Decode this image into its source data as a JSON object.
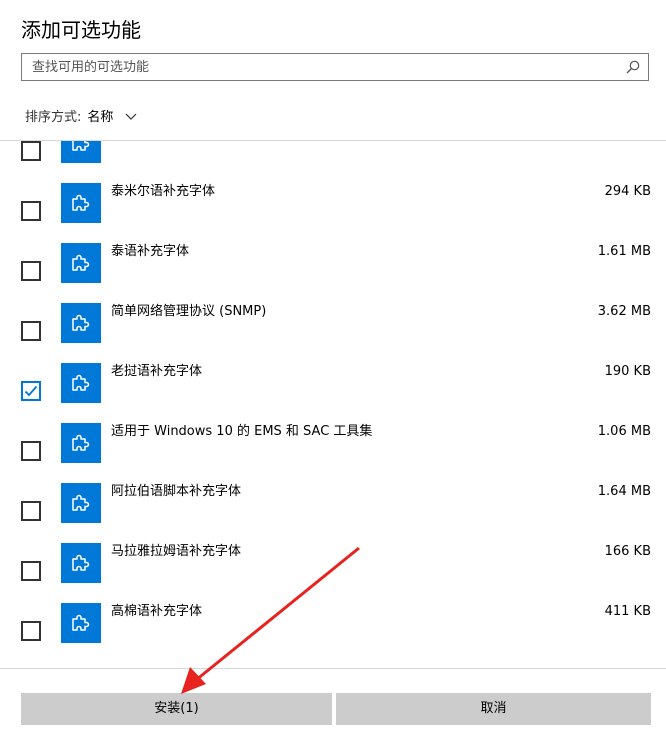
{
  "dialog": {
    "title": "添加可选功能",
    "search_placeholder": "查找可用的可选功能",
    "sort_label": "排序方式:",
    "sort_value": "名称"
  },
  "features": [
    {
      "name": "",
      "size": "",
      "checked": false
    },
    {
      "name": "泰米尔语补充字体",
      "size": "294 KB",
      "checked": false
    },
    {
      "name": "泰语补充字体",
      "size": "1.61 MB",
      "checked": false
    },
    {
      "name": "简单网络管理协议 (SNMP)",
      "size": "3.62 MB",
      "checked": false
    },
    {
      "name": "老挝语补充字体",
      "size": "190 KB",
      "checked": true
    },
    {
      "name": "适用于 Windows 10 的 EMS 和 SAC 工具集",
      "size": "1.06 MB",
      "checked": false
    },
    {
      "name": "阿拉伯语脚本补充字体",
      "size": "1.64 MB",
      "checked": false
    },
    {
      "name": "马拉雅拉姆语补充字体",
      "size": "166 KB",
      "checked": false
    },
    {
      "name": "高棉语补充字体",
      "size": "411 KB",
      "checked": false
    }
  ],
  "buttons": {
    "install": "安装(1)",
    "cancel": "取消"
  },
  "colors": {
    "accent": "#0078d7",
    "annotation_arrow": "#e8231f"
  },
  "icons": {
    "feature": "puzzle-piece-icon",
    "search": "search-icon",
    "sort": "chevron-down-icon"
  }
}
